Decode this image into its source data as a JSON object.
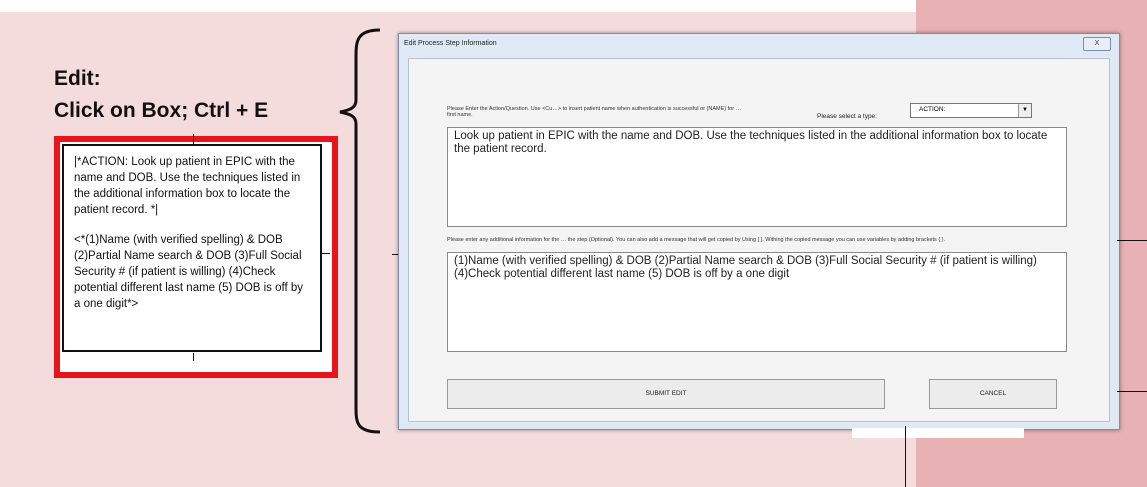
{
  "annotation": {
    "line1": "Edit:",
    "line2": "Click on Box; Ctrl + E"
  },
  "process_box": {
    "action_text": "|*ACTION: Look up patient in EPIC with the name and DOB. Use the techniques listed in the additional information box to locate the patient record. *|",
    "info_text": "<*(1)Name (with verified spelling) & DOB (2)Partial Name search & DOB (3)Full Social Security # (if patient is willing) (4)Check potential different last name (5) DOB is off by a one digit*>"
  },
  "dialog": {
    "title": "Edit Process Step Information",
    "close_label": "X",
    "action_prompt": "Please Enter the Action/Question. Use <Cu…> to insert patient name when authentication is successful or {NAME} for … first name.",
    "type_label": "Please select a type:",
    "type_value": "ACTION:",
    "action_text": "Look up patient in EPIC with the name and DOB. Use the techniques listed in the additional information box to locate the patient record.",
    "info_prompt": "Please enter any additional information for the … the step (Optional). You can also add a message that will get copied by Using [ ]. Withing the copied message you can use variables by adding brackets { }.",
    "info_text": "(1)Name (with verified spelling) & DOB (2)Partial Name search & DOB (3)Full Social Security # (if patient is willing) (4)Check potential different last name (5) DOB is off by a one digit",
    "submit_label": "SUBMIT EDIT",
    "cancel_label": "CANCEL"
  },
  "colors": {
    "background": "#f4dcdd",
    "right_panel": "#e8b1b4",
    "highlight_border": "#e8141b"
  }
}
